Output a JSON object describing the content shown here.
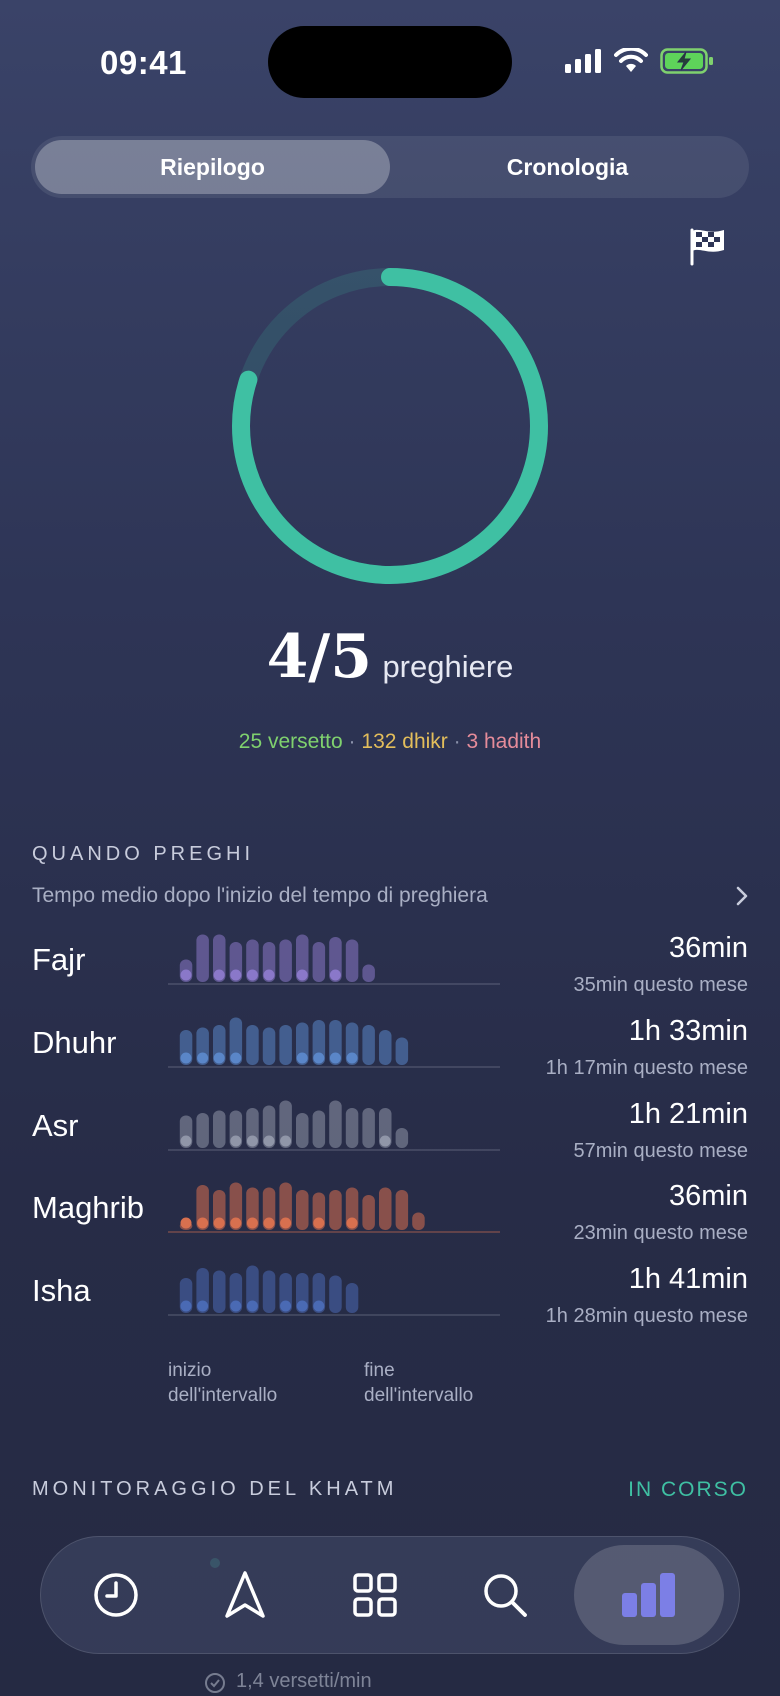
{
  "status_bar": {
    "time": "09:41"
  },
  "segmented": {
    "summary": "Riepilogo",
    "history": "Cronologia"
  },
  "progress": {
    "completed": 4,
    "total": 5,
    "count_text": "4/5",
    "label": "preghiere",
    "fraction": 0.8
  },
  "stats": {
    "verses": "25 versetto",
    "dhikr": "132 dhikr",
    "hadith": "3 hadith",
    "separator": "·",
    "colors": {
      "verses": "#7fd16e",
      "dhikr": "#e3be5b",
      "hadith": "#e58c9a"
    }
  },
  "when_you_pray": {
    "title": "QUANDO PREGHI",
    "subtitle": "Tempo medio dopo l'inizio del tempo di preghiera",
    "prayers": [
      {
        "name": "Fajr",
        "avg": "36min",
        "month": "35min questo mese",
        "color": "#8a78c9",
        "bars": [
          0.45,
          0.95,
          0.95,
          0.8,
          0.85,
          0.8,
          0.85,
          0.95,
          0.8,
          0.9,
          0.85,
          0.35
        ],
        "dots": [
          1,
          0,
          1,
          1,
          1,
          1,
          0,
          1,
          0,
          1,
          0,
          0
        ]
      },
      {
        "name": "Dhuhr",
        "avg": "1h 33min",
        "month": "1h 17min questo mese",
        "color": "#5a86c8",
        "bars": [
          0.7,
          0.75,
          0.8,
          0.95,
          0.8,
          0.75,
          0.8,
          0.85,
          0.9,
          0.9,
          0.85,
          0.8,
          0.7,
          0.55
        ],
        "dots": [
          1,
          1,
          1,
          1,
          0,
          0,
          0,
          1,
          1,
          1,
          1,
          0,
          0,
          0
        ]
      },
      {
        "name": "Asr",
        "avg": "1h 21min",
        "month": "57min questo mese",
        "color": "#9096a8",
        "bars": [
          0.65,
          0.7,
          0.75,
          0.75,
          0.8,
          0.85,
          0.95,
          0.7,
          0.75,
          0.95,
          0.8,
          0.8,
          0.8,
          0.4
        ],
        "dots": [
          1,
          0,
          0,
          1,
          1,
          1,
          1,
          0,
          0,
          0,
          0,
          0,
          1,
          0
        ]
      },
      {
        "name": "Maghrib",
        "avg": "36min",
        "month": "23min questo mese",
        "color": "#d8704f",
        "bars": [
          0.15,
          0.9,
          0.8,
          0.95,
          0.85,
          0.85,
          0.95,
          0.8,
          0.75,
          0.8,
          0.85,
          0.7,
          0.85,
          0.8,
          0.35
        ],
        "dots": [
          1,
          1,
          1,
          1,
          1,
          1,
          1,
          0,
          1,
          0,
          1,
          0,
          0,
          0,
          0
        ]
      },
      {
        "name": "Isha",
        "avg": "1h 41min",
        "month": "1h 28min questo mese",
        "color": "#4a6ab4",
        "bars": [
          0.7,
          0.9,
          0.85,
          0.8,
          0.95,
          0.85,
          0.8,
          0.8,
          0.8,
          0.75,
          0.6
        ],
        "dots": [
          1,
          1,
          0,
          1,
          1,
          0,
          1,
          1,
          1,
          0,
          0
        ]
      }
    ],
    "axis_start": "inizio\ndell'intervallo",
    "axis_end": "fine\ndell'intervallo"
  },
  "khatm": {
    "title": "MONITORAGGIO DEL KHATM",
    "status": "IN CORSO",
    "status_color": "#3fc0a3"
  },
  "behind_tabbar": {
    "rate": "1,4 versetti/min"
  },
  "tabbar": {
    "items": [
      {
        "name": "clock-icon",
        "active": false
      },
      {
        "name": "navigation-icon",
        "active": false
      },
      {
        "name": "grid-icon",
        "active": false
      },
      {
        "name": "search-icon",
        "active": false
      },
      {
        "name": "stats-icon",
        "active": true
      }
    ],
    "accent": "#7c7fe6"
  }
}
